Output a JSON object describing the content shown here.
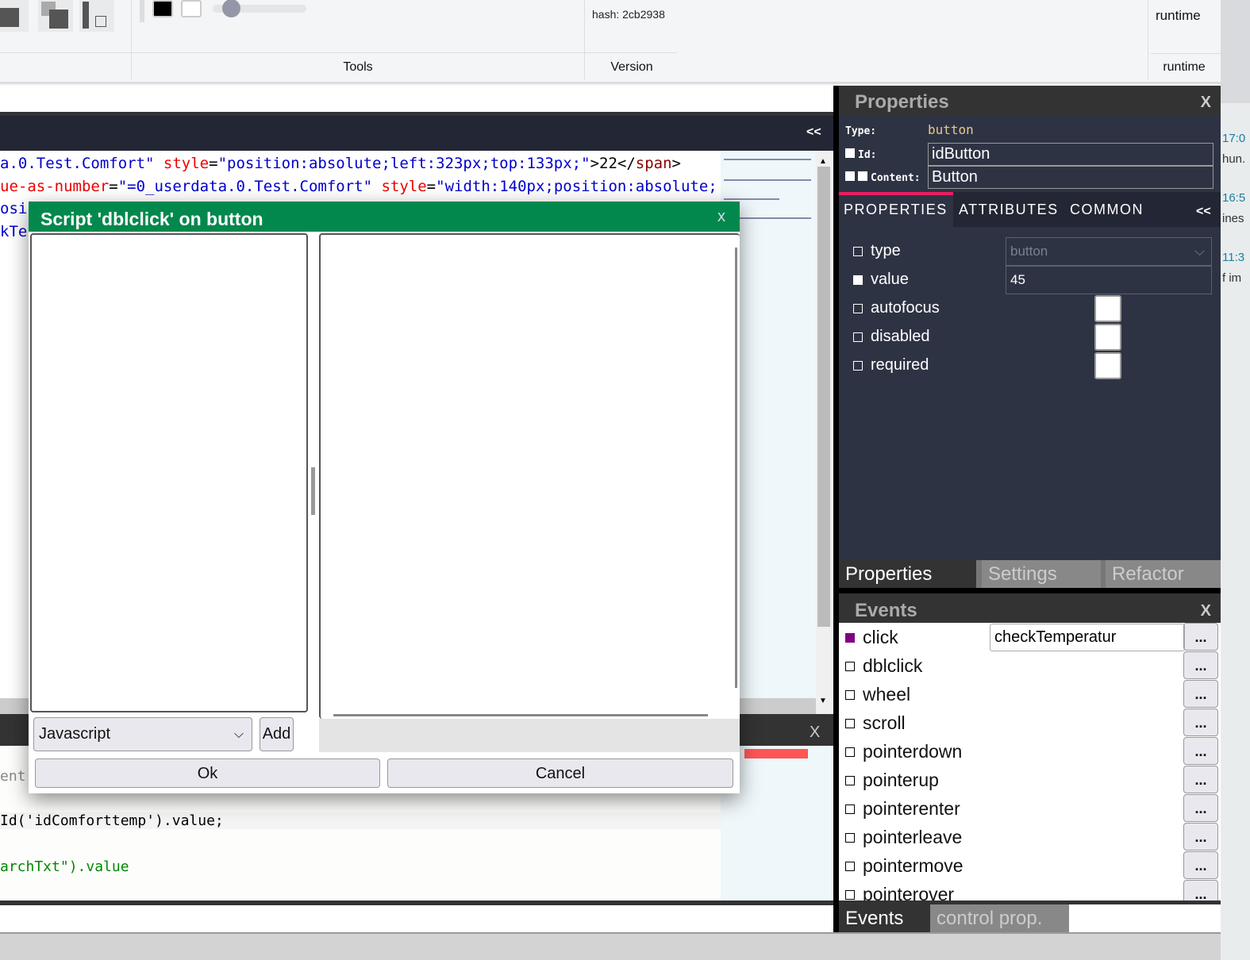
{
  "toolbar": {
    "hash": "hash: 2cb2938",
    "tools_label": "Tools",
    "version_label": "Version",
    "runtime_top": "runtime",
    "runtime_label": "runtime"
  },
  "editor": {
    "collapse": "<<",
    "lines": [
      [
        {
          "c": "str",
          "t": "a.0.Test.Comfort\" "
        },
        {
          "c": "attr",
          "t": "style"
        },
        {
          "c": "plain",
          "t": "="
        },
        {
          "c": "str",
          "t": "\"position:absolute;left:323px;top:133px;\""
        },
        {
          "c": "plain",
          "t": ">22</"
        },
        {
          "c": "tag",
          "t": "span"
        },
        {
          "c": "plain",
          "t": ">"
        }
      ],
      [
        {
          "c": "attr",
          "t": "ue-as-number"
        },
        {
          "c": "plain",
          "t": "="
        },
        {
          "c": "str",
          "t": "\"=0_userdata.0.Test.Comfort\" "
        },
        {
          "c": "attr",
          "t": "style"
        },
        {
          "c": "plain",
          "t": "="
        },
        {
          "c": "str",
          "t": "\"width:140px;position:absolute;"
        }
      ],
      [
        {
          "c": "str",
          "t": "osi"
        }
      ],
      [
        {
          "c": "str",
          "t": "kTe"
        }
      ]
    ]
  },
  "script_panel": {
    "close": "X",
    "line_ent": "ent",
    "line_value": "Id('idComforttemp').value;",
    "line_search": "archTxt\").value"
  },
  "dialog": {
    "title": "Script 'dblclick' on button",
    "close": "x",
    "language": "Javascript",
    "add": "Add",
    "ok": "Ok",
    "cancel": "Cancel"
  },
  "properties": {
    "title": "Properties",
    "close": "X",
    "type_label": "Type:",
    "type_value": "button",
    "id_label": "Id:",
    "id_value": "idButton",
    "content_label": "Content:",
    "content_value": "Button",
    "tabs": [
      "PROPERTIES",
      "ATTRIBUTES",
      "COMMON"
    ],
    "collapse": "<<",
    "rows": [
      {
        "label": "type",
        "value": "button",
        "checked": false
      },
      {
        "label": "value",
        "value": "45",
        "checked": true
      },
      {
        "label": "autofocus",
        "checked": false
      },
      {
        "label": "disabled",
        "checked": false
      },
      {
        "label": "required",
        "checked": false
      }
    ],
    "bottom_tabs": [
      "Properties",
      "Settings",
      "Refactor"
    ]
  },
  "events": {
    "title": "Events",
    "close": "X",
    "dots": "...",
    "click_handler": "checkTemperatur",
    "click_color": "#800080",
    "items": [
      "click",
      "dblclick",
      "wheel",
      "scroll",
      "pointerdown",
      "pointerup",
      "pointerenter",
      "pointerleave",
      "pointermove",
      "pointerover"
    ],
    "bottom_tabs": [
      "Events",
      "control prop."
    ]
  },
  "side_fragments": [
    "17:0",
    "hun.",
    "16:5",
    "ines",
    "11:3",
    "f im"
  ],
  "colors": {
    "dialog_header": "#02884d",
    "accent_tab": "#e91e63",
    "panel_bg": "#2e3344"
  }
}
